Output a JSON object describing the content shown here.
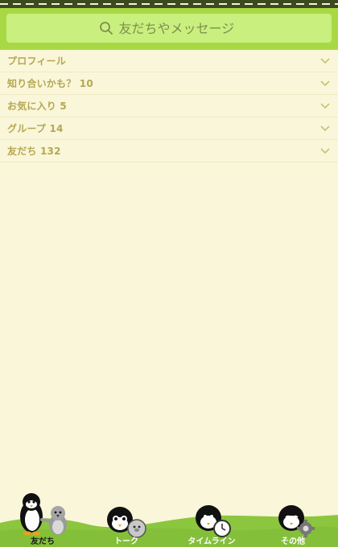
{
  "search": {
    "placeholder": "友だちやメッセージ"
  },
  "sections": [
    {
      "label": "プロフィール"
    },
    {
      "label": "知り合いかも？ 10"
    },
    {
      "label": "お気に入り 5"
    },
    {
      "label": "グループ 14"
    },
    {
      "label": "友だち 132"
    }
  ],
  "tabs": [
    {
      "label": "友だち",
      "active": true
    },
    {
      "label": "トーク",
      "active": false
    },
    {
      "label": "タイムライン",
      "active": false
    },
    {
      "label": "その他",
      "active": false
    }
  ],
  "colors": {
    "background": "#faf6d9",
    "header_green": "#a8d944",
    "search_field": "#c9ef7e",
    "section_text": "#b5a752",
    "grass": "#8cc63f",
    "active_tab_label": "#1a1a1a",
    "inactive_tab_label": "#ffffff"
  },
  "icons": {
    "search": "search-icon",
    "section_toggle": "chevron-down-icon",
    "tabs": [
      "penguin-friends-icon",
      "penguin-talk-icon",
      "penguin-timeline-icon",
      "penguin-more-icon"
    ]
  }
}
